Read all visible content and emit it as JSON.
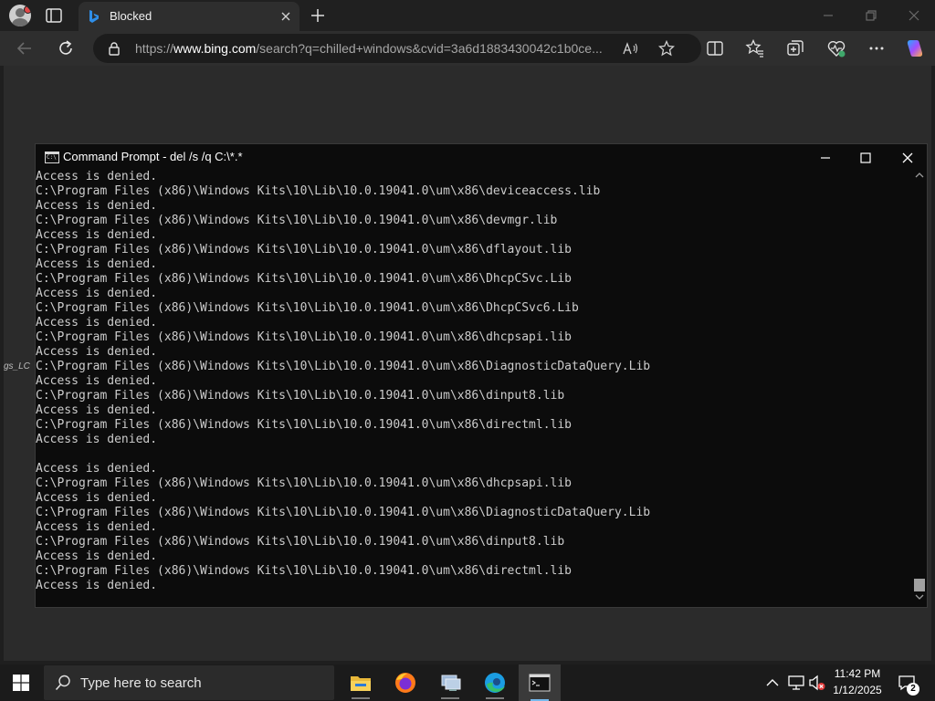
{
  "browser": {
    "tab_title": "Blocked",
    "url_prefix": "https://",
    "url_domain": "www.bing.com",
    "url_rest": "/search?q=chilled+windows&cvid=3a6d1883430042c1b0ce...",
    "side_label": "gs_LC"
  },
  "cmd": {
    "title": "Command Prompt - del  /s /q C:\\*.*",
    "lines": [
      "Access is denied.",
      "C:\\Program Files (x86)\\Windows Kits\\10\\Lib\\10.0.19041.0\\um\\x86\\deviceaccess.lib",
      "Access is denied.",
      "C:\\Program Files (x86)\\Windows Kits\\10\\Lib\\10.0.19041.0\\um\\x86\\devmgr.lib",
      "Access is denied.",
      "C:\\Program Files (x86)\\Windows Kits\\10\\Lib\\10.0.19041.0\\um\\x86\\dflayout.lib",
      "Access is denied.",
      "C:\\Program Files (x86)\\Windows Kits\\10\\Lib\\10.0.19041.0\\um\\x86\\DhcpCSvc.Lib",
      "Access is denied.",
      "C:\\Program Files (x86)\\Windows Kits\\10\\Lib\\10.0.19041.0\\um\\x86\\DhcpCSvc6.Lib",
      "Access is denied.",
      "C:\\Program Files (x86)\\Windows Kits\\10\\Lib\\10.0.19041.0\\um\\x86\\dhcpsapi.lib",
      "Access is denied.",
      "C:\\Program Files (x86)\\Windows Kits\\10\\Lib\\10.0.19041.0\\um\\x86\\DiagnosticDataQuery.Lib",
      "Access is denied.",
      "C:\\Program Files (x86)\\Windows Kits\\10\\Lib\\10.0.19041.0\\um\\x86\\dinput8.lib",
      "Access is denied.",
      "C:\\Program Files (x86)\\Windows Kits\\10\\Lib\\10.0.19041.0\\um\\x86\\directml.lib",
      "Access is denied.",
      "",
      "Access is denied.",
      "C:\\Program Files (x86)\\Windows Kits\\10\\Lib\\10.0.19041.0\\um\\x86\\dhcpsapi.lib",
      "Access is denied.",
      "C:\\Program Files (x86)\\Windows Kits\\10\\Lib\\10.0.19041.0\\um\\x86\\DiagnosticDataQuery.Lib",
      "Access is denied.",
      "C:\\Program Files (x86)\\Windows Kits\\10\\Lib\\10.0.19041.0\\um\\x86\\dinput8.lib",
      "Access is denied.",
      "C:\\Program Files (x86)\\Windows Kits\\10\\Lib\\10.0.19041.0\\um\\x86\\directml.lib",
      "Access is denied."
    ]
  },
  "taskbar": {
    "search_placeholder": "Type here to search",
    "time": "11:42 PM",
    "date": "1/12/2025",
    "notification_count": "2"
  },
  "icons": {
    "browser": [
      "profile-icon",
      "tab-actions-icon",
      "bing-icon",
      "close-icon",
      "plus-icon",
      "minimize-icon",
      "restore-icon",
      "close-icon"
    ],
    "toolbar": [
      "back-icon",
      "refresh-icon",
      "lock-icon",
      "read-aloud-icon",
      "favorite-star-icon",
      "split-screen-icon",
      "favorites-icon",
      "collections-icon",
      "browser-essentials-icon",
      "more-icon",
      "copilot-icon"
    ],
    "taskbar": [
      "windows-start-icon",
      "search-icon",
      "file-explorer-icon",
      "firefox-icon",
      "remote-desktop-icon",
      "edge-icon",
      "command-prompt-icon",
      "chevron-up-icon",
      "network-icon",
      "volume-muted-icon",
      "notifications-icon"
    ]
  },
  "colors": {
    "accent": "#76b9ed",
    "console_text": "#cccccc",
    "console_bg": "#0c0c0c"
  }
}
